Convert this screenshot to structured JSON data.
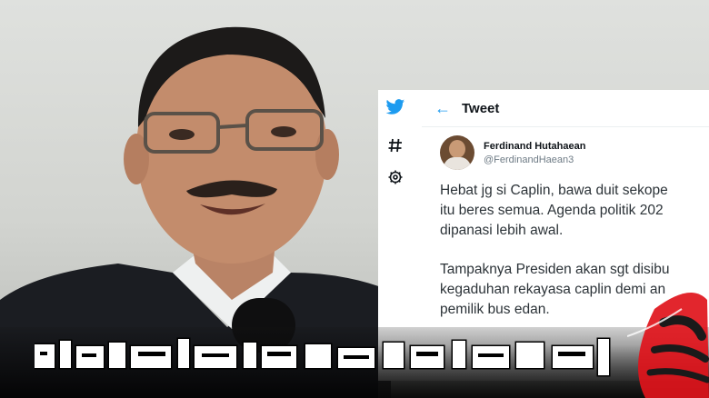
{
  "tweet": {
    "header_title": "Tweet",
    "author_name": "Ferdinand Hutahaean",
    "author_handle": "@FerdinandHaean3",
    "paragraphs": [
      [
        "Hebat jg si Caplin, bawa duit sekope",
        "itu beres semua. Agenda politik 202",
        "dipanasi lebih awal."
      ],
      [
        "Tampaknya Presiden akan sgt disibu",
        "kegaduhan rekayasa caplin demi an",
        "pemilik bus edan."
      ]
    ]
  },
  "icons": {
    "sidebar": [
      "twitter-bird-icon",
      "hashtag-icon",
      "settings-gear-icon"
    ],
    "header": "back-arrow-icon"
  },
  "colors": {
    "twitter_blue": "#1d9bf0",
    "tweet_text": "#2c3338",
    "logo_red": "#e0141b"
  }
}
